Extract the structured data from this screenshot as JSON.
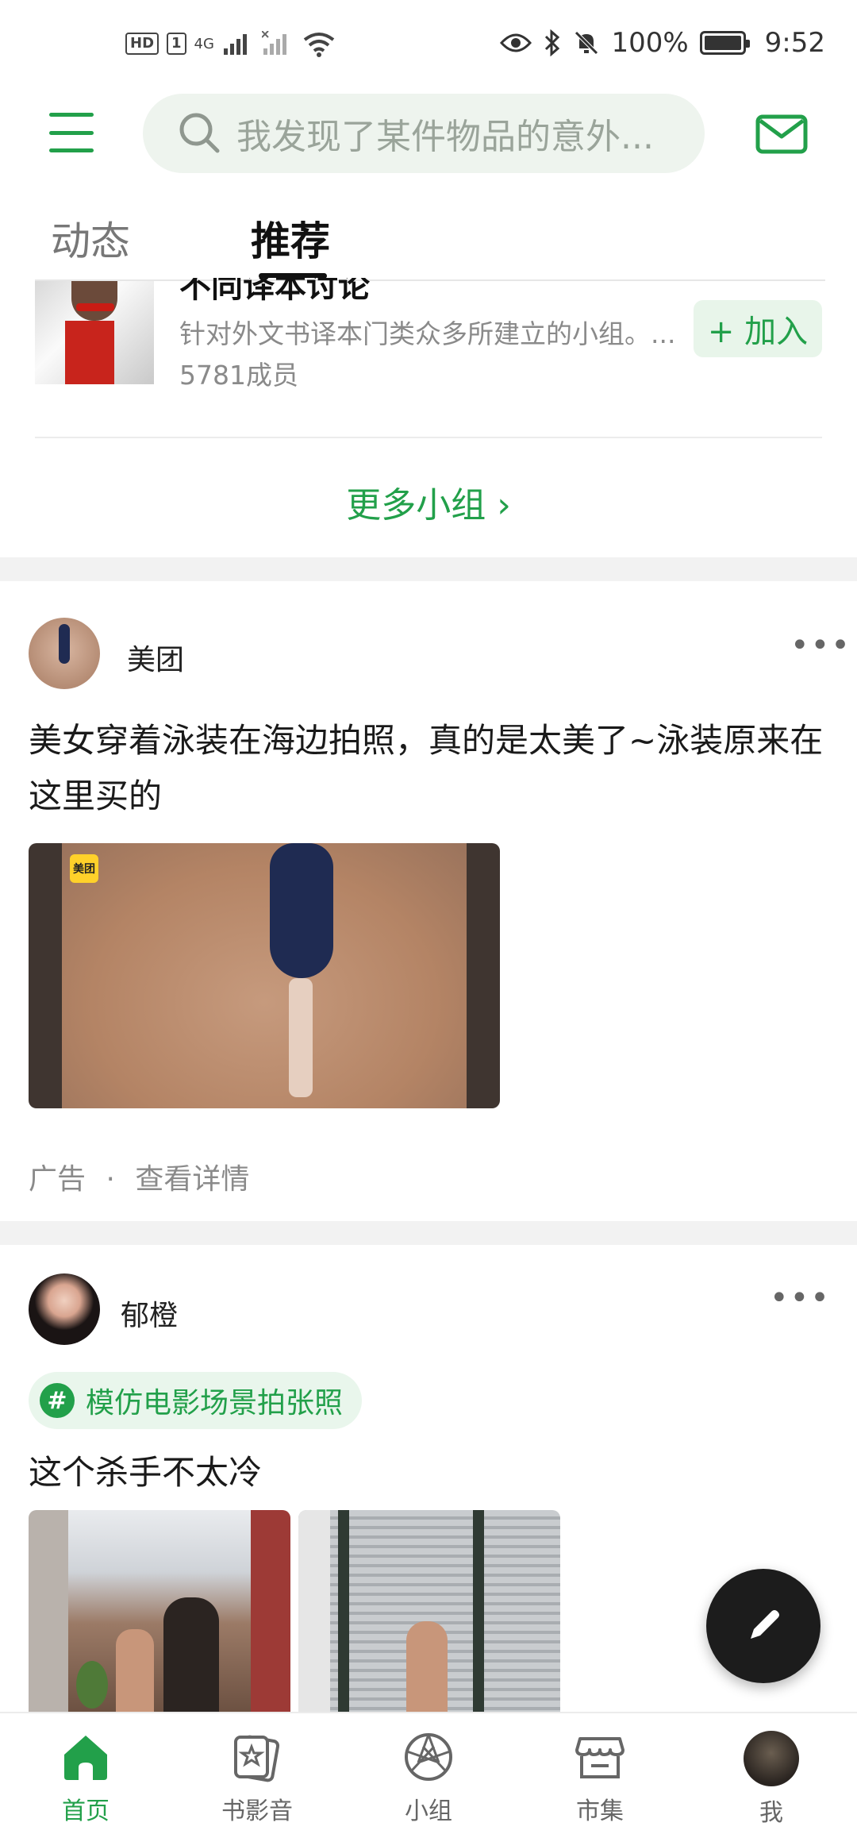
{
  "status_bar": {
    "hd_badge": "HD",
    "sim_slot": "1",
    "network": "4G",
    "battery_percent": "100%",
    "time": "9:52"
  },
  "top_bar": {
    "search_placeholder": "我发现了某件物品的意外..."
  },
  "tabs": [
    {
      "label": "动态",
      "active": false
    },
    {
      "label": "推荐",
      "active": true
    }
  ],
  "group_card": {
    "name": "不同译本讨论",
    "description": "针对外文书译本门类众多所建立的小组。...",
    "members": "5781成员",
    "join_label": "+ 加入",
    "more_groups_label": "更多小组 ›"
  },
  "posts": [
    {
      "author": "美团",
      "text": "美女穿着泳装在海边拍照，真的是太美了~泳装原来在这里买的",
      "image_logo": "美团",
      "meta_ad": "广告",
      "meta_sep": "·",
      "meta_detail": "查看详情"
    },
    {
      "author": "郁橙",
      "topic": "模仿电影场景拍张照",
      "text": "这个杀手不太冷"
    }
  ],
  "bottom_nav": [
    {
      "label": "首页",
      "icon": "home-icon",
      "active": true
    },
    {
      "label": "书影音",
      "icon": "book-film-music-icon",
      "active": false
    },
    {
      "label": "小组",
      "icon": "group-icon",
      "active": false
    },
    {
      "label": "市集",
      "icon": "market-icon",
      "active": false
    },
    {
      "label": "我",
      "icon": "profile-avatar",
      "active": false
    }
  ],
  "colors": {
    "accent": "#22a04a",
    "accent_light": "#e8f5ea",
    "search_bg": "#eef4ee",
    "fab_bg": "#1c1c1c"
  }
}
